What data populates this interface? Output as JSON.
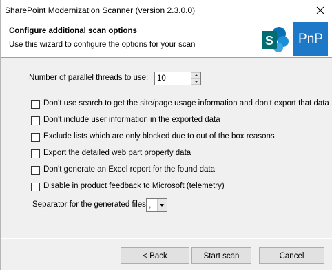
{
  "window": {
    "title": "SharePoint Modernization Scanner (version 2.3.0.0)"
  },
  "banner": {
    "title": "Configure additional scan options",
    "subtitle": "Use this wizard to configure the options for your scan",
    "pnp_logo_text": "PnP",
    "pnp_color": "#1e78c8",
    "sharepoint_color": "#0b6fb4"
  },
  "threads": {
    "label": "Number of parallel threads to use:",
    "value": "10"
  },
  "options": [
    {
      "label": "Don't use search to get the site/page usage information and don't export that data",
      "checked": false
    },
    {
      "label": "Don't include user information in the exported data",
      "checked": false
    },
    {
      "label": "Exclude lists which are only blocked due to out of the box reasons",
      "checked": false
    },
    {
      "label": "Export the detailed web part property data",
      "checked": false
    },
    {
      "label": "Don't generate an Excel report for the found data",
      "checked": false
    },
    {
      "label": "Disable in product feedback to Microsoft (telemetry)",
      "checked": false
    }
  ],
  "separator": {
    "label": "Separator for the generated files:",
    "value": ","
  },
  "buttons": {
    "back": "< Back",
    "start": "Start scan",
    "cancel": "Cancel"
  }
}
